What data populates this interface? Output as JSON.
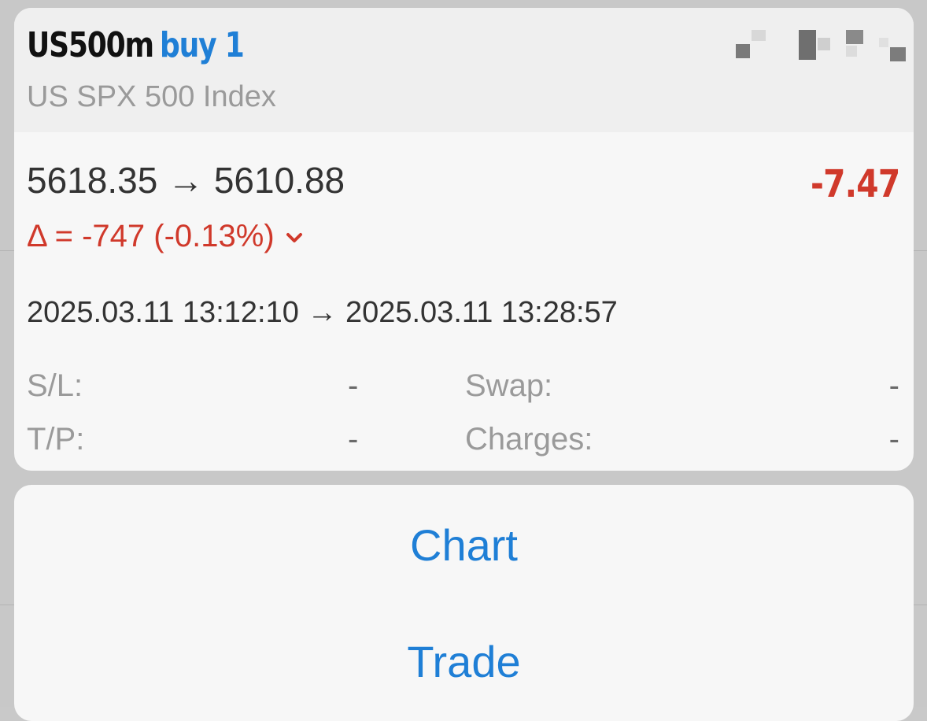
{
  "position": {
    "symbol": "US500m",
    "side_volume": "buy 1",
    "description": "US SPX 500 Index"
  },
  "prices": {
    "line": "5618.35 → 5610.88"
  },
  "profit": "-7.47",
  "delta": {
    "text": "Δ = -747 (-0.13%)"
  },
  "times": {
    "line": "2025.03.11 13:12:10 → 2025.03.11 13:28:57"
  },
  "fields": {
    "sl_label": "S/L:",
    "sl_value": "-",
    "tp_label": "T/P:",
    "tp_value": "-",
    "swap_label": "Swap:",
    "swap_value": "-",
    "charges_label": "Charges:",
    "charges_value": "-"
  },
  "actions": {
    "chart_label": "Chart",
    "trade_label": "Trade"
  },
  "colors": {
    "accent_blue": "#1f7fd6",
    "loss_red": "#d0392b"
  }
}
